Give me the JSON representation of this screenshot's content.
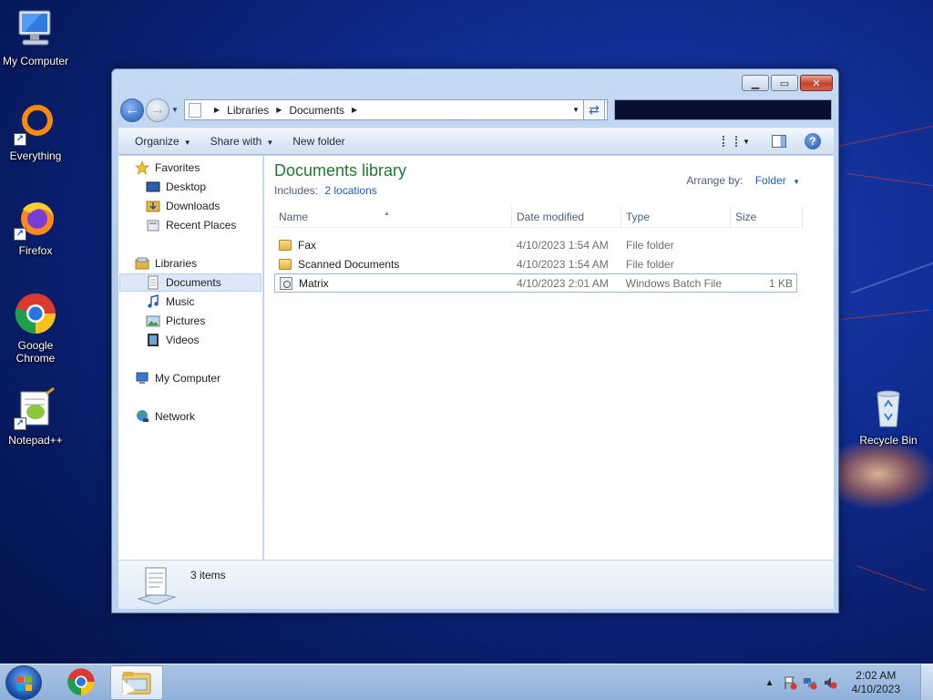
{
  "desktop": {
    "icons": [
      {
        "label": "My Computer",
        "icon": "computer-icon"
      },
      {
        "label": "Everything",
        "icon": "everything-icon"
      },
      {
        "label": "Firefox",
        "icon": "firefox-icon"
      },
      {
        "label": "Google Chrome",
        "icon": "chrome-icon"
      },
      {
        "label": "Notepad++",
        "icon": "notepadpp-icon"
      },
      {
        "label": "Recycle Bin",
        "icon": "recycle-bin-icon"
      }
    ]
  },
  "window": {
    "breadcrumb": [
      "Libraries",
      "Documents"
    ],
    "search_value": "",
    "toolbar": {
      "organize": "Organize",
      "share_with": "Share with",
      "new_folder": "New folder"
    },
    "nav": {
      "favorites": "Favorites",
      "desktop": "Desktop",
      "downloads": "Downloads",
      "recent_places": "Recent Places",
      "libraries": "Libraries",
      "documents": "Documents",
      "music": "Music",
      "pictures": "Pictures",
      "videos": "Videos",
      "my_computer": "My Computer",
      "network": "Network"
    },
    "library": {
      "title": "Documents library",
      "includes_label": "Includes:",
      "includes_link": "2 locations",
      "arrange_label": "Arrange by:",
      "arrange_value": "Folder"
    },
    "columns": {
      "name": "Name",
      "date": "Date modified",
      "type": "Type",
      "size": "Size"
    },
    "files": [
      {
        "name": "Fax",
        "date": "4/10/2023 1:54 AM",
        "type": "File folder",
        "size": ""
      },
      {
        "name": "Scanned Documents",
        "date": "4/10/2023 1:54 AM",
        "type": "File folder",
        "size": ""
      },
      {
        "name": "Matrix",
        "date": "4/10/2023 2:01 AM",
        "type": "Windows Batch File",
        "size": "1 KB"
      }
    ],
    "status": {
      "count": "3 items"
    }
  },
  "taskbar": {
    "clock_time": "2:02 AM",
    "clock_date": "4/10/2023"
  },
  "colors": {
    "library_title": "#1e7b2e",
    "link": "#1e5bb8",
    "desktop_bg": "#0e2a8c"
  }
}
